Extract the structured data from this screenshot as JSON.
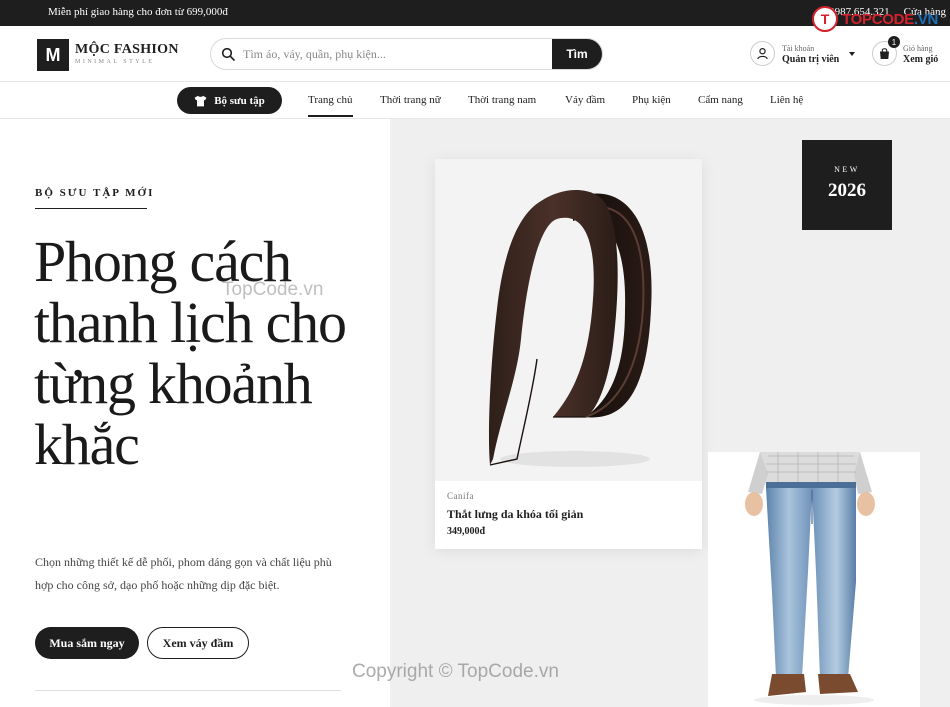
{
  "topbar": {
    "promo": "Miễn phí giao hàng cho đơn từ 699,000đ",
    "phone": "0987.654.321",
    "store": "Cửa hàng"
  },
  "watermark": {
    "logo_text": "TOPCODE",
    "logo_suffix": ".VN",
    "center_text": "TopCode.vn",
    "copyright": "Copyright © TopCode.vn"
  },
  "header": {
    "logo_letter": "M",
    "brand_name": "MỘC FASHION",
    "brand_tagline": "MINIMAL STYLE",
    "search": {
      "placeholder": "Tìm áo, váy, quần, phụ kiện...",
      "button": "Tìm"
    },
    "account": {
      "label": "Tài khoản",
      "name": "Quản trị viên"
    },
    "cart": {
      "count": "1",
      "label": "Giỏ hàng",
      "action": "Xem giỏ"
    }
  },
  "nav": {
    "collection_button": "Bộ sưu tập",
    "items": [
      "Trang chủ",
      "Thời trang nữ",
      "Thời trang nam",
      "Váy đầm",
      "Phụ kiện",
      "Cẩm nang",
      "Liên hệ"
    ]
  },
  "hero": {
    "eyebrow": "BỘ SƯU TẬP MỚI",
    "headline": "Phong cách thanh lịch cho từng khoảnh khắc",
    "description": "Chọn những thiết kế dễ phối, phom dáng gọn và chất liệu phù hợp cho công sở, dạo phố hoặc những dịp đặc biệt.",
    "primary_button": "Mua sắm ngay",
    "secondary_button": "Xem váy đầm"
  },
  "badge": {
    "label": "NEW",
    "year": "2026"
  },
  "product": {
    "brand": "Canifa",
    "name": "Thắt lưng da khóa tối giản",
    "price": "349,000đ"
  },
  "colors": {
    "dark": "#1e1e1e",
    "hero_bg": "#efefef",
    "watermark_red": "#d2222d"
  }
}
